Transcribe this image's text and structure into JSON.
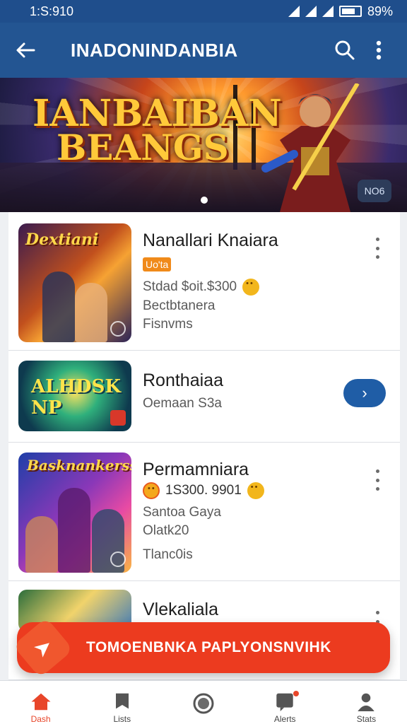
{
  "status_bar": {
    "time": "1:S:910",
    "battery": "89%"
  },
  "app_bar": {
    "title": "INADONINDANBIA"
  },
  "banner": {
    "title_line1": "IANBAIBAN",
    "title_line2": "BEANGS",
    "badge": "ΝΟ6",
    "page_indicator_active": 1
  },
  "games": [
    {
      "title": "Nanallari Knaiara",
      "tag": "Uo'ta",
      "line1": "Stdad $oit.$300",
      "line2": "Bectbtanera",
      "line3": "Fisnvms",
      "thumb_label": "Dextiani"
    },
    {
      "title": "Ronthaiaa",
      "line1": "Oemaan S3a",
      "thumb_label": "ALHDSK NP"
    },
    {
      "title": "Permamniara",
      "line1": "1S300. 9901",
      "line2": "Santoa Gaya",
      "line3": "Olatk20",
      "line4": "Tlanc0is",
      "thumb_label": "Basknankerss"
    },
    {
      "title": "Vlekaliala"
    }
  ],
  "promo": {
    "text": "TOMOENBNKA PAPLYONSNVIHK"
  },
  "bottom_nav": [
    {
      "label": "Dash",
      "icon": "home-icon",
      "active": true
    },
    {
      "label": "Lists",
      "icon": "flag-icon",
      "active": false
    },
    {
      "label": "",
      "icon": "record-icon",
      "active": false
    },
    {
      "label": "Alerts",
      "icon": "badge-icon",
      "active": false
    },
    {
      "label": "Stats",
      "icon": "person-icon",
      "active": false
    }
  ],
  "colors": {
    "app_bar": "#235592",
    "accent": "#ec3b1f",
    "button_blue": "#1f5da6"
  }
}
